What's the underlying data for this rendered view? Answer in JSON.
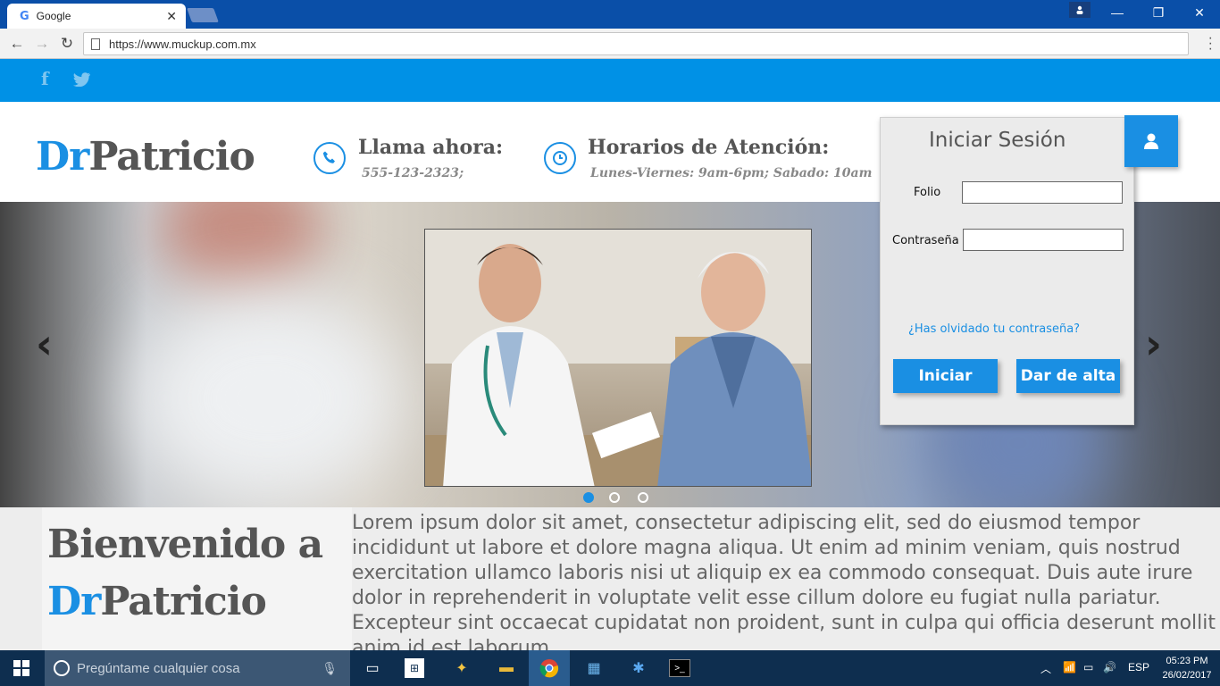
{
  "browser": {
    "tab_title": "Google",
    "tab_favicon": "G",
    "tab_close": "✕",
    "url": "https://www.muckup.com.mx",
    "window_controls": {
      "minimize": "—",
      "maximize": "❐",
      "close": "✕"
    }
  },
  "site": {
    "social": {
      "facebook": "f",
      "twitter": "🐦"
    },
    "logo": {
      "accent": "Dr",
      "rest": "Patricio"
    },
    "call": {
      "title": "Llama ahora:",
      "value": "555-123-2323;"
    },
    "hours": {
      "title": "Horarios de Atención:",
      "value": "Lunes-Viernes: 9am-6pm; Sabado: 10am"
    },
    "slider": {
      "active_slide": 1,
      "total_slides": 3,
      "prev": "‹",
      "next": "›"
    },
    "welcome": {
      "line1": "Bienvenido a",
      "accent": "Dr",
      "rest": "Patricio",
      "body": "Lorem ipsum dolor sit amet, consectetur adipiscing elit, sed do eiusmod tempor incididunt ut labore et dolore magna aliqua. Ut enim ad minim veniam, quis nostrud exercitation ullamco laboris nisi ut aliquip ex ea commodo consequat. Duis aute irure dolor in reprehenderit in voluptate velit esse cillum dolore eu fugiat nulla pariatur. Excepteur sint occaecat cupidatat non proident, sunt in culpa qui officia deserunt mollit anim id est laborum."
    },
    "login": {
      "title": "Iniciar Sesión",
      "folio_label": "Folio",
      "password_label": "Contraseña",
      "forgot": "¿Has olvidado tu contraseña?",
      "login_button": "Iniciar",
      "signup_button": "Dar de alta"
    },
    "colors": {
      "accent": "#1a8fe3",
      "social_bar": "#0091e6"
    }
  },
  "taskbar": {
    "search_placeholder": "Pregúntame cualquier cosa",
    "language": "ESP",
    "time": "05:23 PM",
    "date": "26/02/2017"
  }
}
